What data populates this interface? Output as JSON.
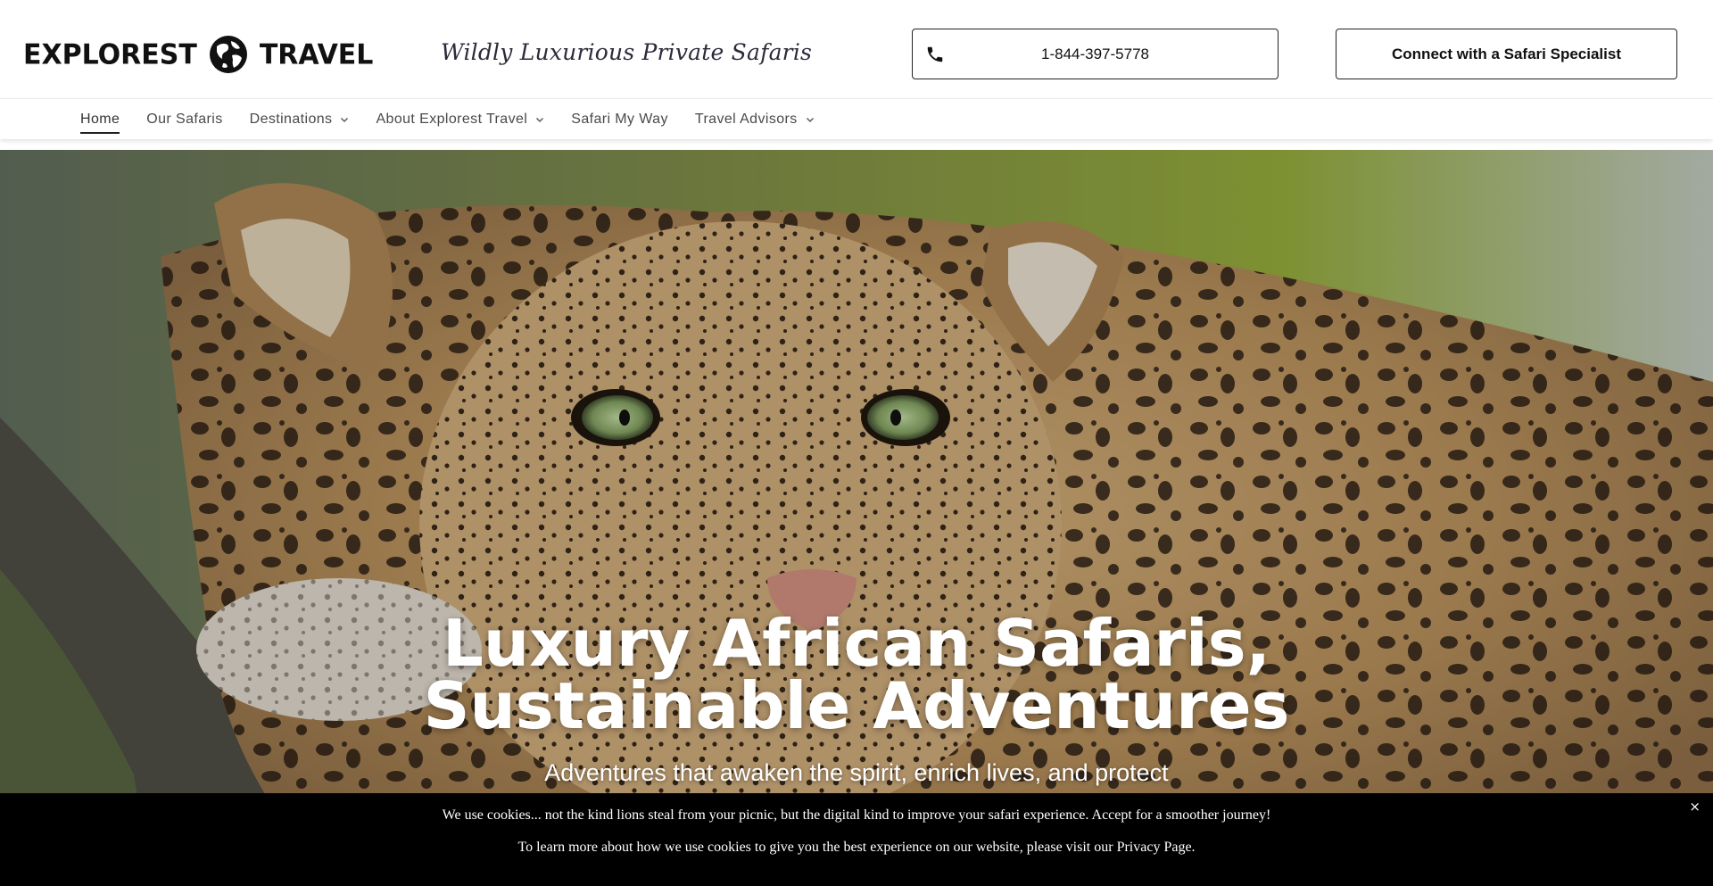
{
  "header": {
    "logo_left": "EXPLOREST",
    "logo_right": "TRAVEL",
    "logo_icon": "globe-icon",
    "tagline": "Wildly Luxurious Private Safaris",
    "phone_icon": "phone-icon",
    "phone_label": "1-844-397-5778",
    "cta_label": "Connect with a Safari Specialist"
  },
  "nav": {
    "items": [
      {
        "label": "Home",
        "active": true
      },
      {
        "label": "Our Safaris"
      },
      {
        "label": "Destinations",
        "dropdown": true
      },
      {
        "label": "About Explorest Travel",
        "dropdown": true
      },
      {
        "label": "Safari My Way"
      },
      {
        "label": "Travel Advisors",
        "dropdown": true
      }
    ]
  },
  "hero": {
    "title_line1": "Luxury African Safaris,",
    "title_line2": "Sustainable Adventures",
    "subtitle": "Adventures that awaken the spirit, enrich lives, and protect"
  },
  "cookie": {
    "line1": "We use cookies... not the kind lions steal from your picnic, but the digital kind to improve your safari experience. Accept for a smoother journey!",
    "line2": "To learn more about how we use cookies to give you the best experience on our website, please visit our Privacy Page.",
    "close": "×"
  },
  "colors": {
    "text_dark": "#111111",
    "nav_text": "#4a4a4a",
    "cookie_bg": "#000000",
    "hero_text": "#ffffff"
  }
}
